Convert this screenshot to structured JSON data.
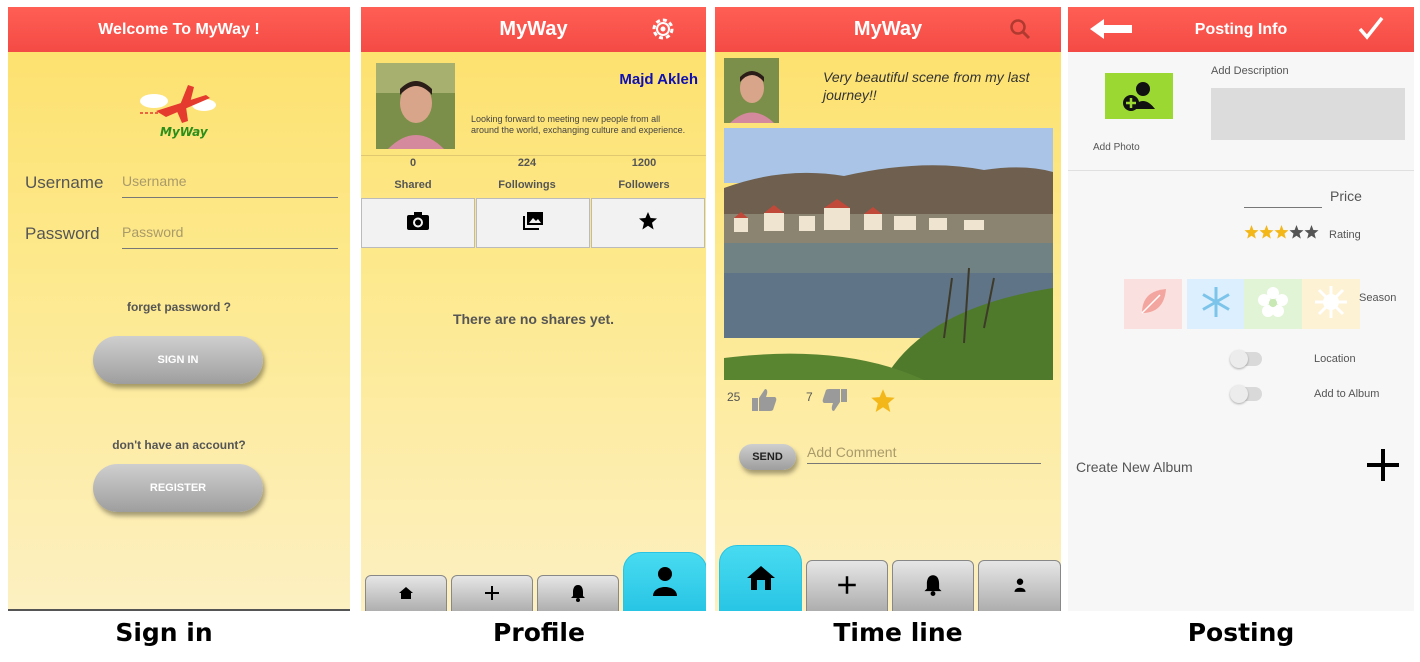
{
  "signin": {
    "title": "Welcome To MyWay !",
    "logo_text": "MyWay",
    "username_label": "Username",
    "username_placeholder": "Username",
    "password_label": "Password",
    "password_placeholder": "Password",
    "forget": "forget password ?",
    "signin_button": "SIGN IN",
    "no_account": "don't have an account?",
    "register_button": "REGISTER",
    "caption": "Sign in"
  },
  "profile": {
    "title": "MyWay",
    "name": "Majd Akleh",
    "bio": "Looking forward to meeting new people from all around the world, exchanging culture and experience.",
    "stats": [
      {
        "num": "0",
        "label": "Shared"
      },
      {
        "num": "224",
        "label": "Followings"
      },
      {
        "num": "1200",
        "label": "Followers"
      }
    ],
    "empty": "There are no shares yet.",
    "caption": "Profile"
  },
  "timeline": {
    "title": "MyWay",
    "post_text": "Very beautiful scene from my last journey!!",
    "likes": "25",
    "dislikes": "7",
    "send_button": "SEND",
    "comment_placeholder": "Add Comment",
    "caption": "Time line"
  },
  "posting": {
    "title": "Posting Info",
    "add_photo": "Add Photo",
    "add_description": "Add Description",
    "price": "Price",
    "rating_label": "Rating",
    "rating_value": 3,
    "rating_max": 5,
    "season": "Season",
    "location": "Location",
    "add_to_album": "Add to Album",
    "create_album": "Create New Album",
    "caption": "Posting"
  },
  "colors": {
    "topbar": "#f44a45",
    "active_tab": "#27c4e4",
    "name": "#1010b0",
    "star": "#f4b71a"
  }
}
